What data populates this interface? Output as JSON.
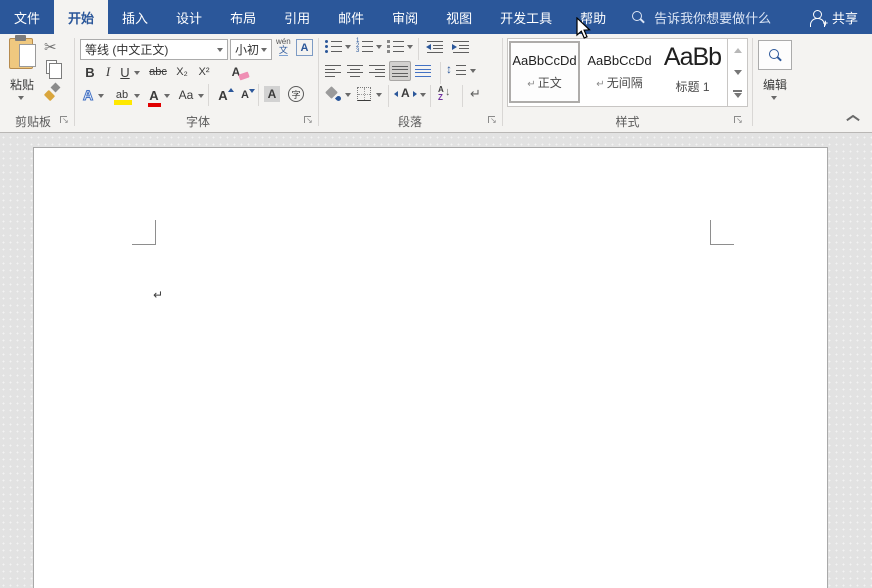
{
  "titlebar": {
    "tabs": [
      {
        "label": "文件"
      },
      {
        "label": "开始",
        "active": true
      },
      {
        "label": "插入"
      },
      {
        "label": "设计"
      },
      {
        "label": "布局"
      },
      {
        "label": "引用"
      },
      {
        "label": "邮件"
      },
      {
        "label": "审阅"
      },
      {
        "label": "视图"
      },
      {
        "label": "开发工具"
      },
      {
        "label": "帮助"
      }
    ],
    "search_label": "告诉我你想要做什么",
    "share_label": "共享"
  },
  "ribbon": {
    "clipboard": {
      "label": "剪贴板",
      "paste_label": "粘贴"
    },
    "font": {
      "label": "字体",
      "name_value": "等线 (中文正文)",
      "size_value": "小初"
    },
    "paragraph": {
      "label": "段落"
    },
    "styles": {
      "label": "样式",
      "items": [
        {
          "preview": "AaBbCcDd",
          "mark": "↵",
          "name": "正文",
          "selected": true
        },
        {
          "preview": "AaBbCcDd",
          "mark": "↵",
          "name": "无间隔"
        },
        {
          "preview": "AaBb",
          "mark": "",
          "name": "标题 1"
        }
      ]
    },
    "edit": {
      "label": "编辑"
    }
  },
  "icons": {
    "cut": "✂",
    "bold": "B",
    "italic": "I",
    "underline": "U",
    "strikethrough": "abc",
    "subscript": "X₂",
    "superscript": "X²",
    "clear_format": "A",
    "text_effects": "A",
    "highlight": "ab",
    "font_color": "A",
    "change_case": "Aa",
    "grow_font": "A",
    "shrink_font": "A",
    "char_shading": "A",
    "enclose_char": "字",
    "phonetic_top": "wén",
    "phonetic_bottom": "文",
    "char_border": "A",
    "sort_a": "A",
    "sort_z": "Z",
    "show_marks": "↵"
  },
  "document": {
    "paragraph_mark": "↵"
  },
  "colors": {
    "titlebar": "#2b579a",
    "ribbon_bg": "#f4f3f1",
    "accent_blue": "#2b579a",
    "doc_bg": "#e2e2e2",
    "highlight_yellow": "#ffe800",
    "font_color_red": "#e00000"
  }
}
